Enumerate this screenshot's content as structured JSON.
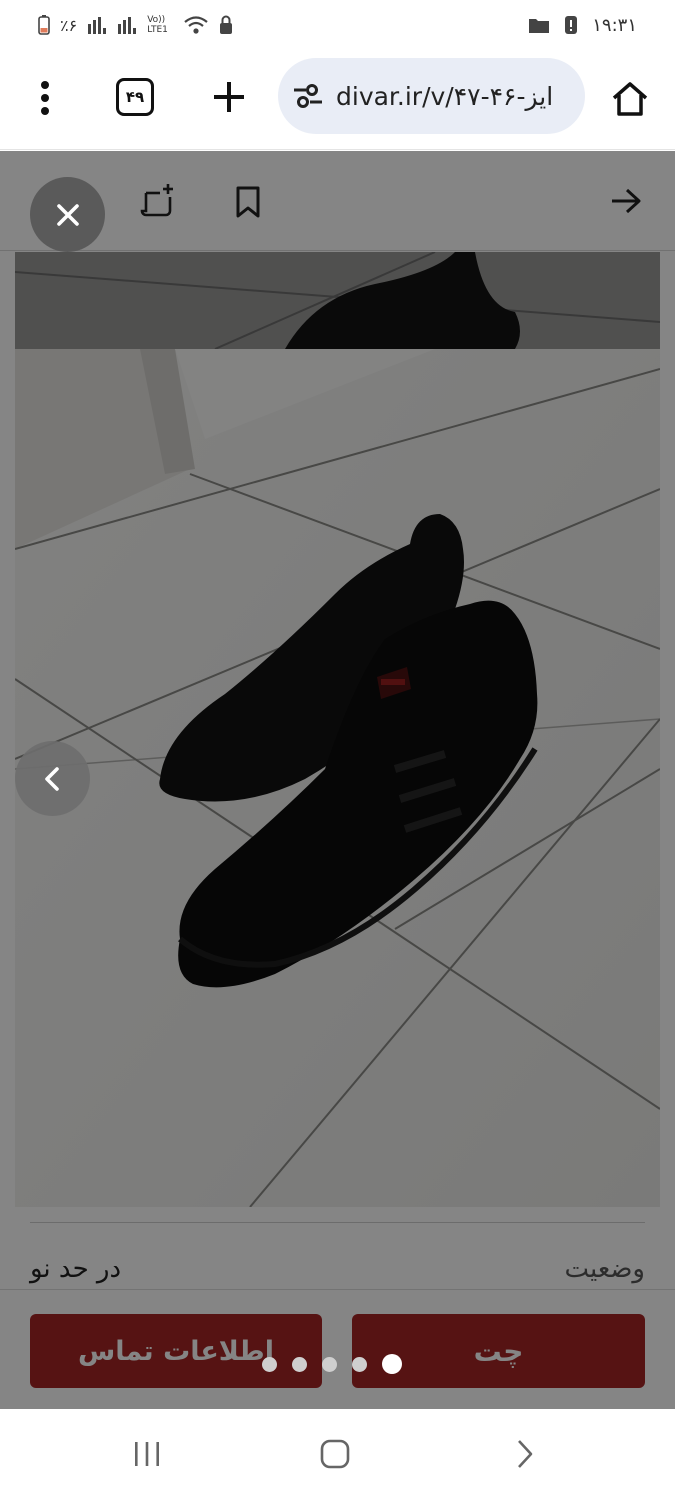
{
  "status_bar": {
    "battery_text": "٪۶",
    "volte_label": "Vo)) LTE1",
    "time": "۱۹:۳۱"
  },
  "browser": {
    "tab_count": "۴۹",
    "url": "divar.ir/v/ایز-۴۶-۴۷"
  },
  "toolbar": {
    "close_icon": "close-icon",
    "note_icon": "add-note-icon",
    "bookmark_icon": "bookmark-icon",
    "forward_icon": "arrow-right-icon"
  },
  "gallery": {
    "image_count": 5,
    "active_index": 4,
    "prev_icon": "chevron-left-icon"
  },
  "details": {
    "condition_label": "وضعیت",
    "condition_value": "در حد نو"
  },
  "actions": {
    "contact_label": "اطلاعات تماس",
    "chat_label": "چت",
    "button_color": "#a62626"
  },
  "nav": {
    "recent_icon": "recent-apps-icon",
    "home_icon": "home-circle-icon",
    "back_icon": "nav-back-icon"
  }
}
